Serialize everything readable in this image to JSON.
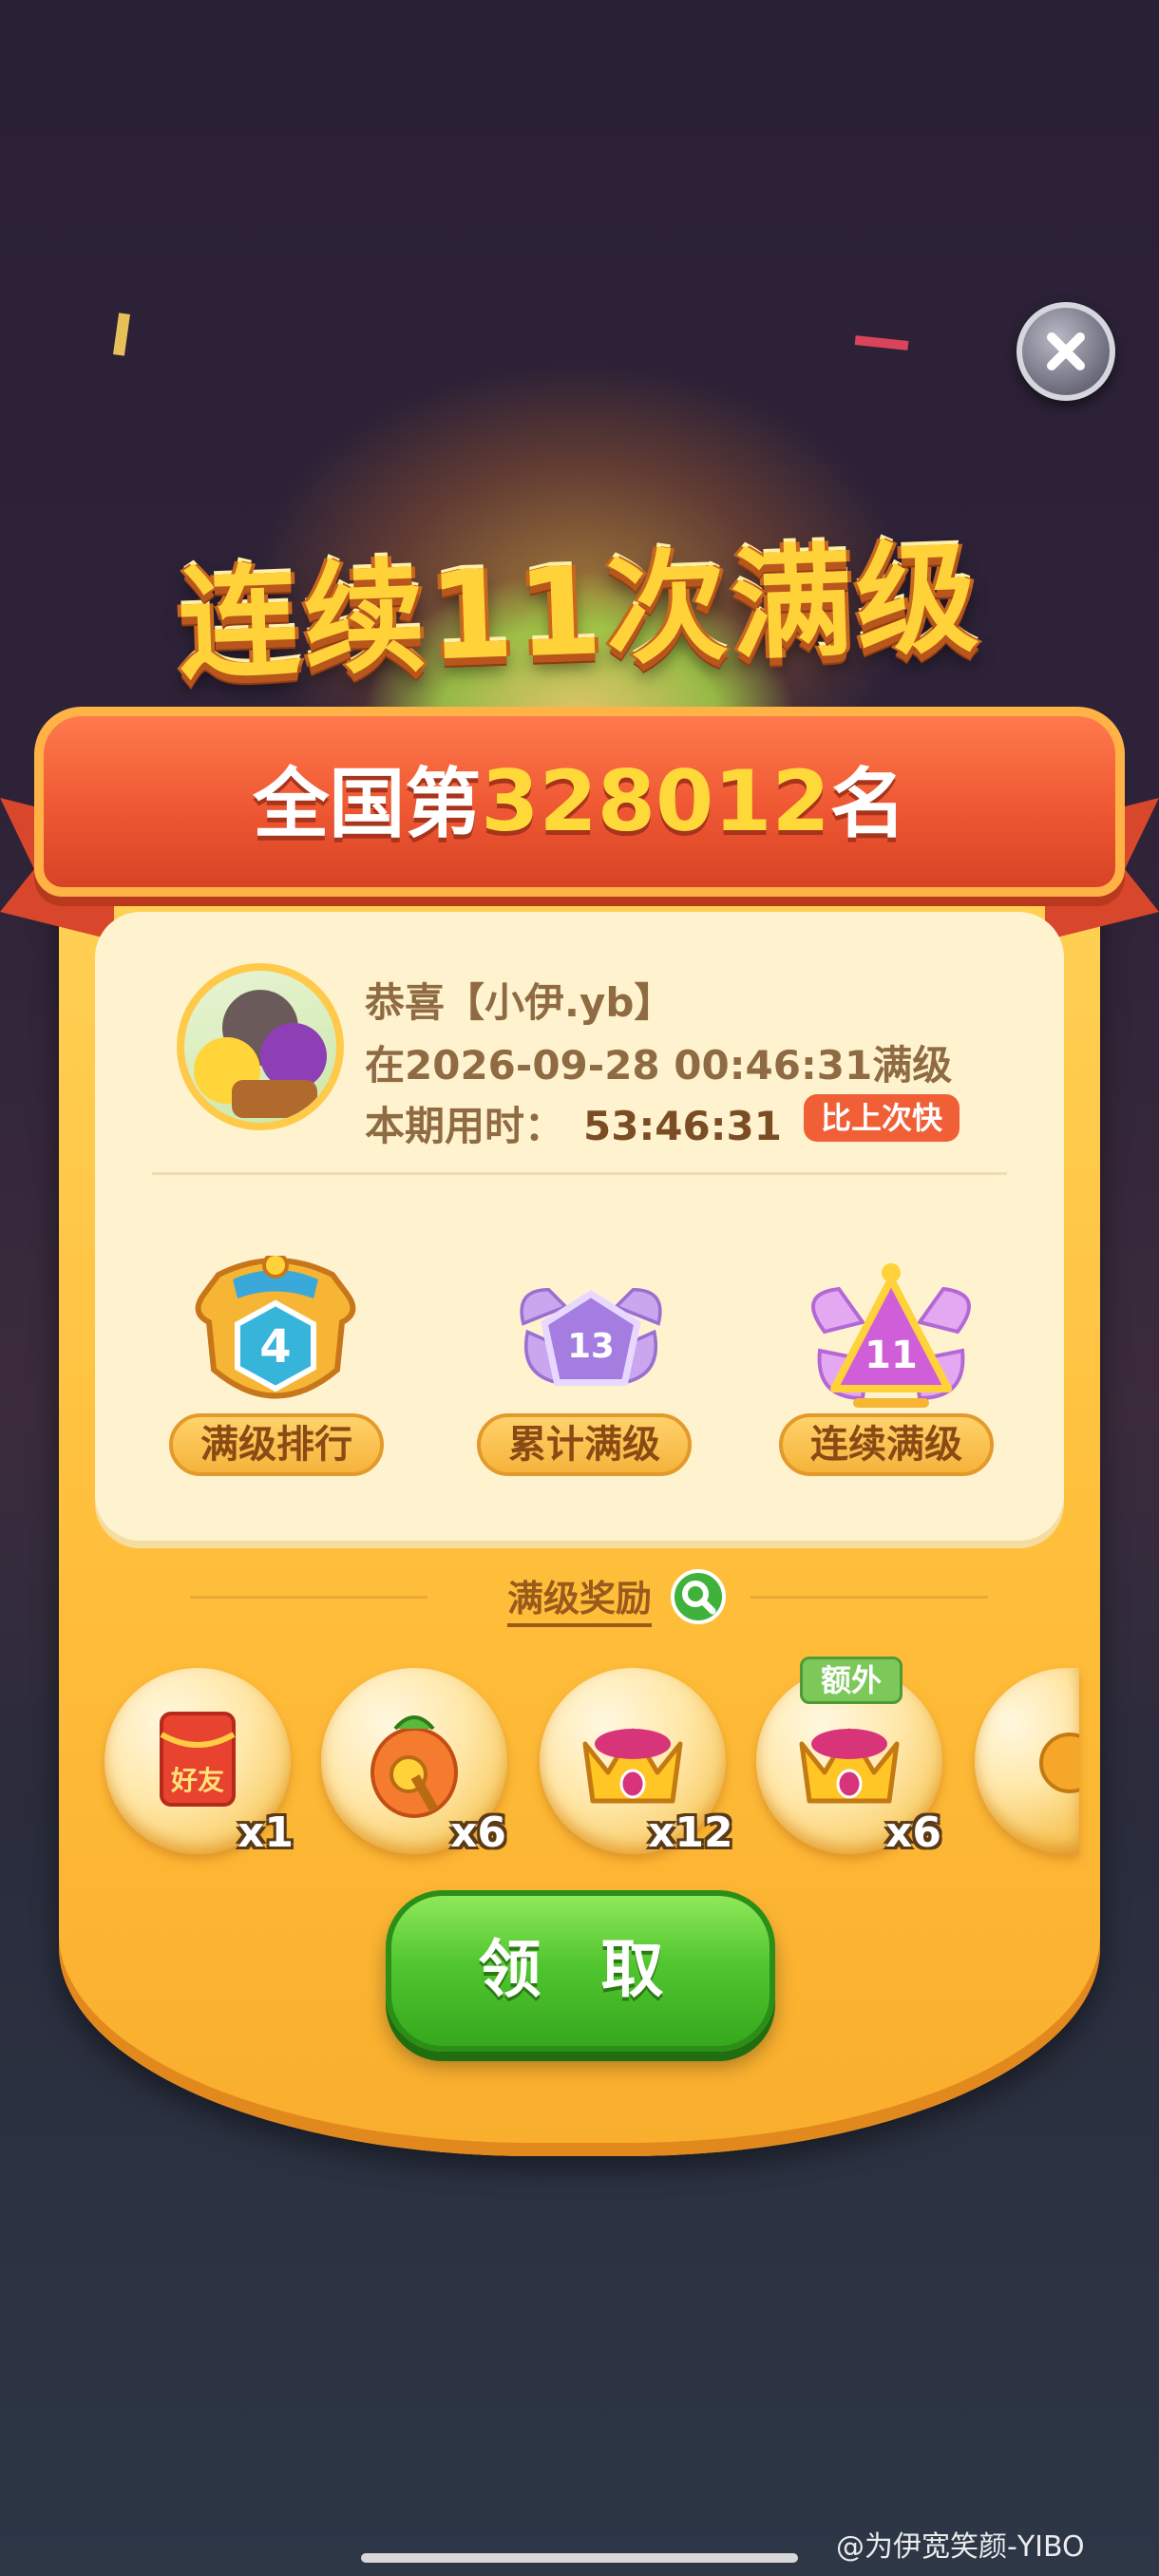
{
  "title": "连续11次满级",
  "rank": {
    "prefix": "全国第",
    "number": "328012",
    "suffix": "名"
  },
  "user": {
    "congrats": "恭喜【小伊.yb】",
    "maxed_at": "在2026-09-28 00:46:31满级",
    "period_label": "本期用时：",
    "period_time": "53:46:31",
    "faster_badge": "比上次快"
  },
  "badges": [
    {
      "number": "4",
      "label": "满级排行",
      "icon": "crown-shield-icon",
      "color": "#2fb2d8"
    },
    {
      "number": "13",
      "label": "累计满级",
      "icon": "winged-pentagon-icon",
      "color": "#a56fd8"
    },
    {
      "number": "11",
      "label": "连续满级",
      "icon": "winged-triangle-icon",
      "color": "#c856d8"
    }
  ],
  "rewards_title": "满级奖励",
  "rewards": [
    {
      "icon": "red-envelope-icon",
      "text": "好友",
      "count": "x1"
    },
    {
      "icon": "magic-vase-icon",
      "count": "x6"
    },
    {
      "icon": "crown-icon",
      "count": "x12"
    },
    {
      "icon": "crown-icon",
      "count": "x6",
      "extra": "额外"
    },
    {
      "icon": "partial-reward-icon"
    }
  ],
  "claim_label": "领 取",
  "watermark": "@为伊宽笑颜-YIBO"
}
